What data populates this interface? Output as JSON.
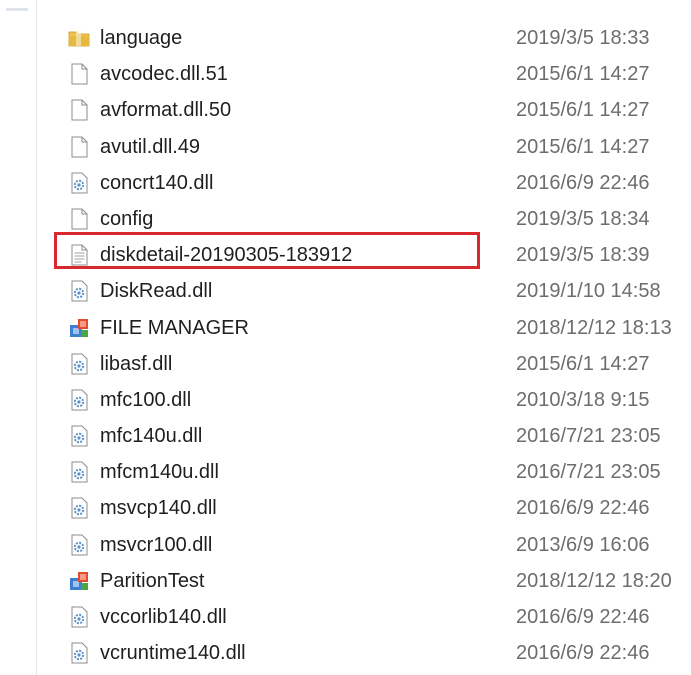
{
  "files": [
    {
      "name": "language",
      "date": "2019/3/5 18:33",
      "icon": "folder-icon"
    },
    {
      "name": "avcodec.dll.51",
      "date": "2015/6/1 14:27",
      "icon": "file-icon"
    },
    {
      "name": "avformat.dll.50",
      "date": "2015/6/1 14:27",
      "icon": "file-icon"
    },
    {
      "name": "avutil.dll.49",
      "date": "2015/6/1 14:27",
      "icon": "file-icon"
    },
    {
      "name": "concrt140.dll",
      "date": "2016/6/9 22:46",
      "icon": "dll-icon"
    },
    {
      "name": "config",
      "date": "2019/3/5 18:34",
      "icon": "file-icon"
    },
    {
      "name": "diskdetail-20190305-183912",
      "date": "2019/3/5 18:39",
      "icon": "text-file-icon"
    },
    {
      "name": "DiskRead.dll",
      "date": "2019/1/10 14:58",
      "icon": "dll-icon"
    },
    {
      "name": "FILE MANAGER",
      "date": "2018/12/12 18:13",
      "icon": "app-icon"
    },
    {
      "name": "libasf.dll",
      "date": "2015/6/1 14:27",
      "icon": "dll-icon"
    },
    {
      "name": "mfc100.dll",
      "date": "2010/3/18 9:15",
      "icon": "dll-icon"
    },
    {
      "name": "mfc140u.dll",
      "date": "2016/7/21 23:05",
      "icon": "dll-icon"
    },
    {
      "name": "mfcm140u.dll",
      "date": "2016/7/21 23:05",
      "icon": "dll-icon"
    },
    {
      "name": "msvcp140.dll",
      "date": "2016/6/9 22:46",
      "icon": "dll-icon"
    },
    {
      "name": "msvcr100.dll",
      "date": "2013/6/9 16:06",
      "icon": "dll-icon"
    },
    {
      "name": "ParitionTest",
      "date": "2018/12/12 18:20",
      "icon": "app-icon"
    },
    {
      "name": "vccorlib140.dll",
      "date": "2016/6/9 22:46",
      "icon": "dll-icon"
    },
    {
      "name": "vcruntime140.dll",
      "date": "2016/6/9 22:46",
      "icon": "dll-icon"
    }
  ],
  "highlight": {
    "color": "#d9292f",
    "target": "diskdetail-20190305-183912"
  },
  "colors": {
    "folder": "#e8b93f",
    "dll_gear": "#5b8fc9",
    "date_text": "#6d6d6d"
  }
}
